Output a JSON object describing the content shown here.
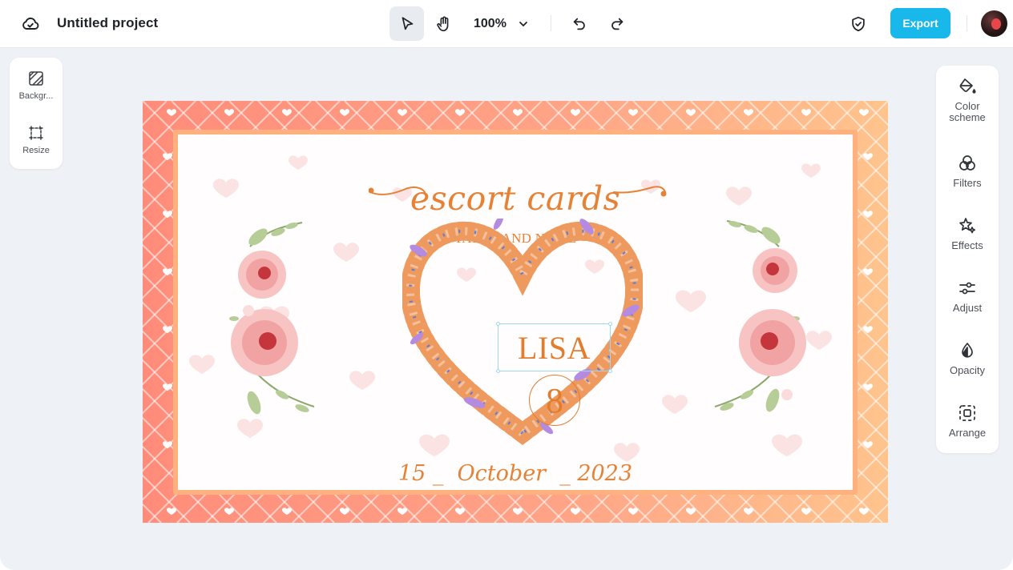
{
  "header": {
    "project_title": "Untitled project",
    "zoom_level": "100%",
    "export_label": "Export"
  },
  "left_panel": {
    "items": [
      {
        "label": "Backgr...",
        "icon": "background-icon"
      },
      {
        "label": "Resize",
        "icon": "resize-icon"
      }
    ]
  },
  "right_panel": {
    "items": [
      {
        "label": "Color scheme",
        "icon": "paint-bucket-icon"
      },
      {
        "label": "Filters",
        "icon": "filters-icon"
      },
      {
        "label": "Effects",
        "icon": "sparkle-icon"
      },
      {
        "label": "Adjust",
        "icon": "sliders-icon"
      },
      {
        "label": "Opacity",
        "icon": "drop-icon"
      },
      {
        "label": "Arrange",
        "icon": "arrange-icon"
      }
    ]
  },
  "canvas": {
    "title": "escort cards",
    "subtitle": "TABLE AND NAME",
    "guest_name": "LISA",
    "table_number": "8",
    "date": "15 _  October  _ 2023"
  },
  "colors": {
    "accent": "#18b8ea",
    "card_text": "#e58236",
    "frame_left": "#ff8c7a",
    "frame_right": "#ffc48d",
    "selection": "#9ed8f0"
  }
}
